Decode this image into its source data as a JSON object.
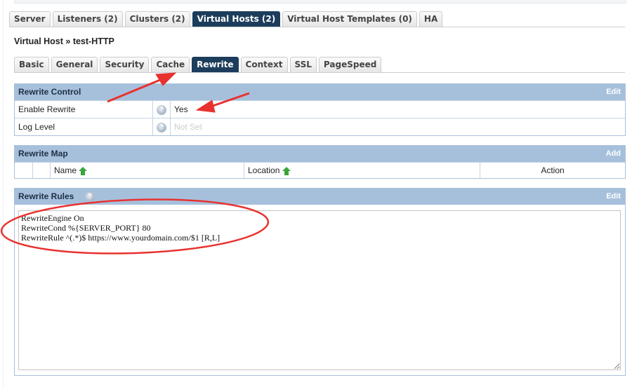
{
  "main_tabs": [
    {
      "label": "Server"
    },
    {
      "label": "Listeners (2)"
    },
    {
      "label": "Clusters (2)"
    },
    {
      "label": "Virtual Hosts (2)",
      "active": true
    },
    {
      "label": "Virtual Host Templates (0)"
    },
    {
      "label": "HA"
    }
  ],
  "breadcrumb": "Virtual Host » test-HTTP",
  "sub_tabs": [
    {
      "label": "Basic"
    },
    {
      "label": "General"
    },
    {
      "label": "Security"
    },
    {
      "label": "Cache"
    },
    {
      "label": "Rewrite",
      "active": true
    },
    {
      "label": "Context"
    },
    {
      "label": "SSL"
    },
    {
      "label": "PageSpeed"
    }
  ],
  "rewrite_control": {
    "title": "Rewrite Control",
    "action": "Edit",
    "rows": [
      {
        "label": "Enable Rewrite",
        "value": "Yes"
      },
      {
        "label": "Log Level",
        "value": "Not Set"
      }
    ]
  },
  "rewrite_map": {
    "title": "Rewrite Map",
    "action": "Add",
    "columns": [
      "Name",
      "Location",
      "Action"
    ]
  },
  "rewrite_rules": {
    "title": "Rewrite Rules",
    "action": "Edit",
    "content": "RewriteEngine On\nRewriteCond %{SERVER_PORT} 80\nRewriteRule ^(.*)$ https://www.yourdomain.com/$1 [R,L]"
  },
  "colors": {
    "active_tab": "#1d3d5c",
    "panel_header": "#a6c0dc",
    "annotation": "#e8322f",
    "sort_arrow": "#3aa63a"
  },
  "icons": {
    "help": "question-circle",
    "sort": "arrow-up"
  }
}
